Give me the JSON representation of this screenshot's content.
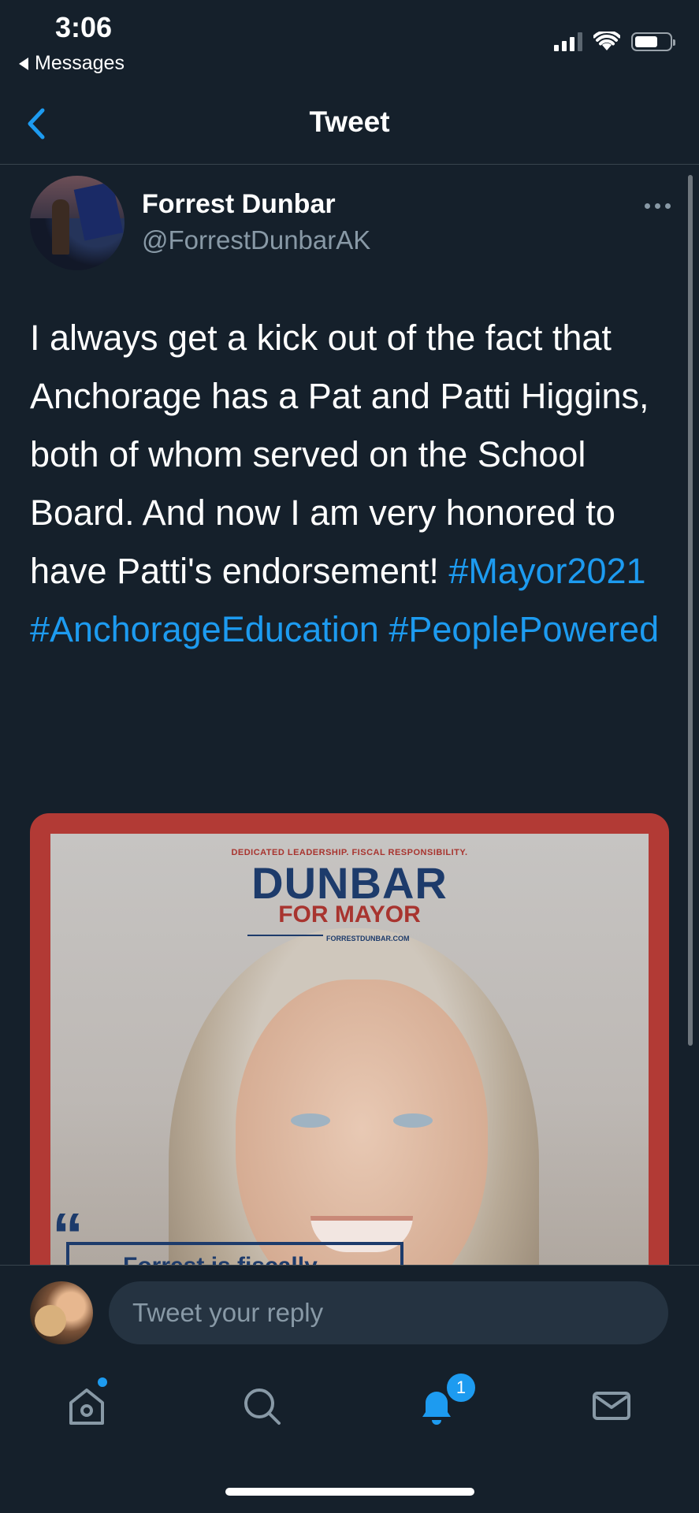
{
  "status": {
    "time": "3:06",
    "back_app": "Messages"
  },
  "nav": {
    "title": "Tweet"
  },
  "tweet": {
    "author_name": "Forrest Dunbar",
    "author_handle": "@ForrestDunbarAK",
    "text_plain": "I always get a kick out of the fact that Anchorage has a Pat and Patti Higgins, both of whom served on the School Board. And now I am very honored to have Patti's endorsement!",
    "hashtags": [
      "#Mayor2021",
      "#AnchorageEducation",
      "#PeoplePowered"
    ],
    "media": {
      "tagline": "DEDICATED LEADERSHIP. FISCAL RESPONSIBILITY.",
      "logo": "DUNBAR",
      "logo_sub": "FOR MAYOR",
      "url": "FORRESTDUNBAR.COM",
      "quote": "Forrest is fiscally"
    }
  },
  "reply": {
    "placeholder": "Tweet your reply"
  },
  "tabs": {
    "items": [
      "home",
      "search",
      "notifications",
      "messages"
    ],
    "notifications_badge": "1"
  },
  "colors": {
    "background": "#15202b",
    "accent": "#1d9bf0",
    "secondary_text": "#8899a6",
    "media_frame": "#b23a35",
    "logo_navy": "#1d3b6b"
  },
  "icons": {
    "nav_back": "chevron-left-icon",
    "more": "ellipsis-icon",
    "home": "home-icon",
    "search": "search-icon",
    "notifications": "bell-icon",
    "messages": "mail-icon"
  }
}
